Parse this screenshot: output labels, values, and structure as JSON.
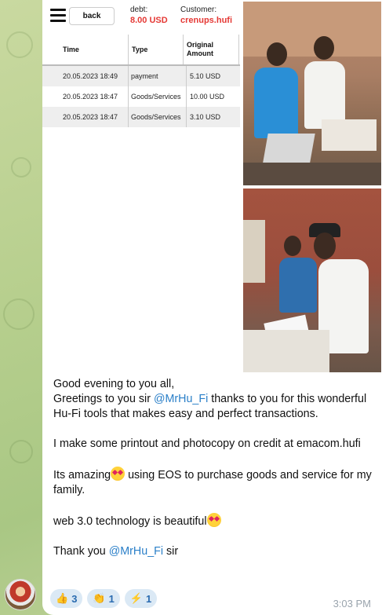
{
  "receipt": {
    "back_label": "back",
    "debt_label": "debt:",
    "debt_value": "8.00 USD",
    "customer_label": "Customer:",
    "customer_value": "crenups.hufi",
    "columns": [
      "Time",
      "Type",
      "Original Amount"
    ],
    "rows": [
      {
        "time": "20.05.2023 18:49",
        "type": "payment",
        "amount": "5.10 USD"
      },
      {
        "time": "20.05.2023 18:47",
        "type": "Goods/Services",
        "amount": "10.00 USD"
      },
      {
        "time": "20.05.2023 18:47",
        "type": "Goods/Services",
        "amount": "3.10 USD"
      }
    ]
  },
  "message": {
    "greeting": "Good evening to you all,",
    "line2_pre": "Greetings to you sir ",
    "mention": "@MrHu_Fi",
    "line2_post": "  thanks to you for this wonderful Hu-Fi tools  that makes easy and perfect transactions.",
    "para2": "I make some printout and photocopy on credit at emacom.hufi",
    "para3_pre": "Its amazing",
    "para3_post": " using EOS to purchase goods and service for my family.",
    "para4": "web 3.0 technology is beautiful",
    "thanks_pre": "Thank you ",
    "thanks_post": " sir",
    "emoji": "heart-eyes-emoji"
  },
  "reactions": [
    {
      "icon": "thumbs-up",
      "glyph": "👍",
      "count": "3"
    },
    {
      "icon": "clapping-hands",
      "glyph": "👏",
      "count": "1"
    },
    {
      "icon": "lightning",
      "glyph": "⚡",
      "count": "1"
    }
  ],
  "timestamp": "3:03 PM"
}
